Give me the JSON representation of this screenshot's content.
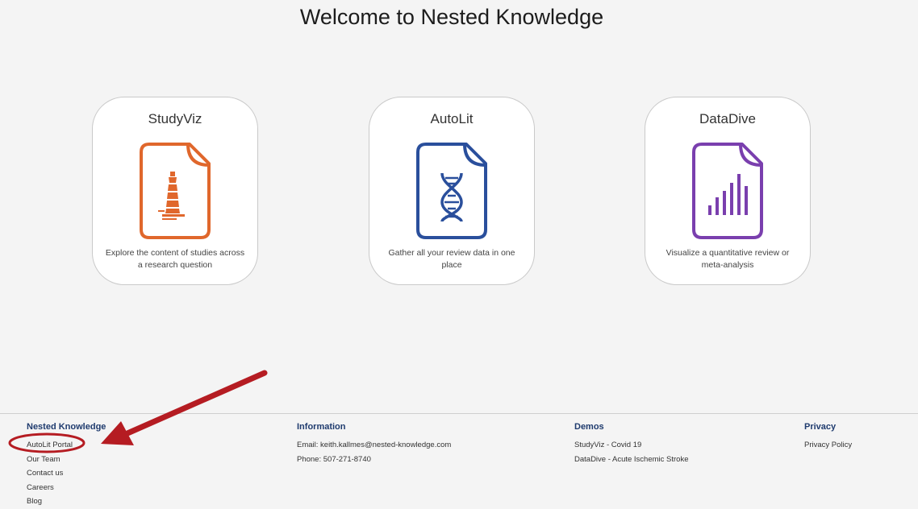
{
  "page": {
    "title": "Welcome to Nested Knowledge"
  },
  "cards": [
    {
      "title": "StudyViz",
      "description": "Explore the content of studies across a research question",
      "icon": "lighthouse-document-icon",
      "color": "#e0672c"
    },
    {
      "title": "AutoLit",
      "description": "Gather all your review data in one place",
      "icon": "dna-document-icon",
      "color": "#2a4f9c"
    },
    {
      "title": "DataDive",
      "description": "Visualize a quantitative review or meta-analysis",
      "icon": "bar-chart-document-icon",
      "color": "#7a3fae"
    }
  ],
  "footer": {
    "nested_knowledge": {
      "heading": "Nested Knowledge",
      "links": [
        "AutoLit Portal",
        "Our Team",
        "Contact us",
        "Careers",
        "Blog"
      ]
    },
    "information": {
      "heading": "Information",
      "email": "Email: keith.kallmes@nested-knowledge.com",
      "phone": "Phone: 507-271-8740"
    },
    "demos": {
      "heading": "Demos",
      "links": [
        "StudyViz - Covid 19",
        "DataDive - Acute Ischemic Stroke"
      ]
    },
    "privacy": {
      "heading": "Privacy",
      "links": [
        "Privacy Policy"
      ]
    }
  },
  "colors": {
    "footer_heading": "#1f3b6e",
    "annotation": "#b51c22",
    "background": "#f4f4f4"
  },
  "annotation": {
    "arrow": "red-arrow-icon",
    "circle": "red-ellipse-highlight"
  }
}
